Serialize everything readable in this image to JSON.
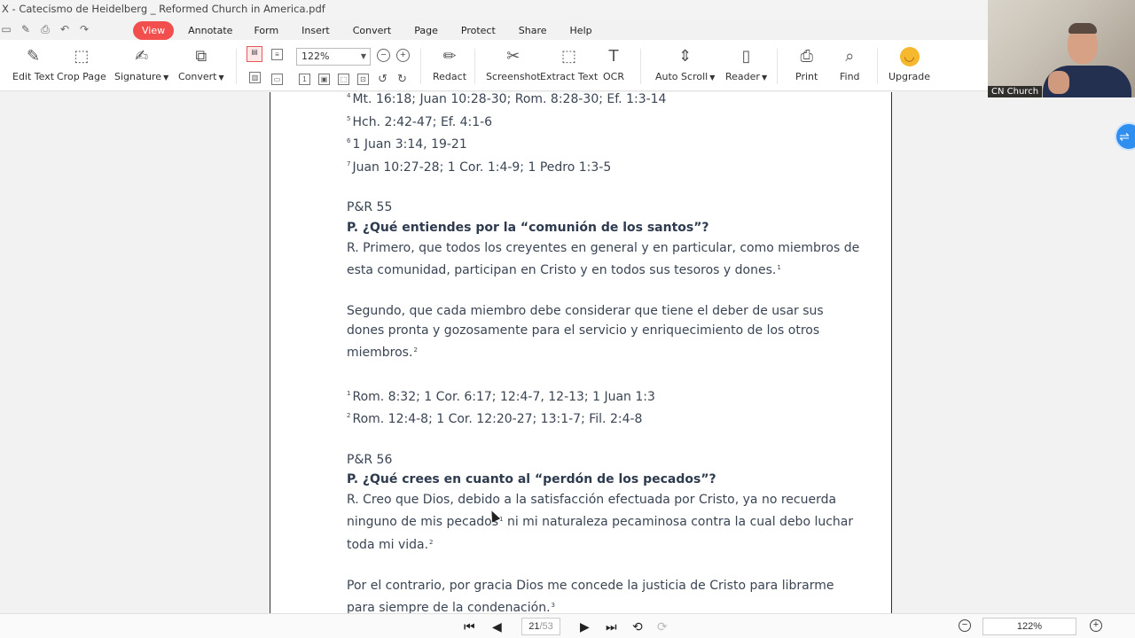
{
  "window": {
    "title": "X - Catecismo de Heidelberg _ Reformed Church in America.pdf"
  },
  "menu": {
    "tabs": [
      {
        "label": "View",
        "active": true
      },
      {
        "label": "Annotate"
      },
      {
        "label": "Form"
      },
      {
        "label": "Insert"
      },
      {
        "label": "Convert"
      },
      {
        "label": "Page"
      },
      {
        "label": "Protect"
      },
      {
        "label": "Share"
      },
      {
        "label": "Help"
      }
    ],
    "accent_color": "#f24e4e"
  },
  "ribbon": {
    "edit_text": "Edit Text",
    "crop_page": "Crop Page",
    "signature": "Signature",
    "convert": "Convert",
    "zoom_value": "122%",
    "redact": "Redact",
    "screenshot": "Screenshot",
    "extract_text": "Extract Text",
    "ocr": "OCR",
    "auto_scroll": "Auto Scroll",
    "reader": "Reader",
    "print": "Print",
    "find": "Find",
    "upgrade": "Upgrade"
  },
  "document": {
    "fn_a": [
      {
        "num": "4",
        "text": "Mt. 16:18; Juan 10:28-30; Rom. 8:28-30; Ef. 1:3-14"
      },
      {
        "num": "5",
        "text": "Hch. 2:42-47; Ef. 4:1-6"
      },
      {
        "num": "6",
        "text": "1 Juan 3:14, 19-21"
      },
      {
        "num": "7",
        "text": "Juan 10:27-28; 1 Cor. 1:4-9; 1 Pedro 1:3-5"
      }
    ],
    "q55": {
      "heading": "P&R 55",
      "question": "P. ¿Qué entiendes por la “comunión de los santos”?",
      "answer_l1": "R. Primero, que todos los creyentes en general y en particular, como miembros de",
      "answer_l2": "esta comunidad, participan en Cristo y en todos sus tesoros y dones.",
      "answer_l2_sup": "1",
      "p2_l1": "Segundo, que cada miembro debe considerar que tiene el deber de usar sus",
      "p2_l2": "dones pronta y gozosamente para el servicio y enriquecimiento de los otros",
      "p2_l3": "miembros.",
      "p2_l3_sup": "2",
      "fn": [
        {
          "num": "1",
          "text": "Rom. 8:32; 1 Cor. 6:17; 12:4-7, 12-13; 1 Juan 1:3"
        },
        {
          "num": "2",
          "text": "Rom. 12:4-8; 1 Cor. 12:20-27; 13:1-7; Fil. 2:4-8"
        }
      ]
    },
    "q56": {
      "heading": "P&R 56",
      "question": "P. ¿Qué crees en cuanto al “perdón de los pecados”?",
      "answer_l1": "R. Creo que Dios, debido a la satisfacción efectuada por Cristo, ya no recuerda",
      "answer_l2a": "ninguno de mis pecados",
      "answer_l2_sup": "1",
      "answer_l2b": " ni mi naturaleza pecaminosa contra la cual debo luchar",
      "answer_l3": "toda mi vida.",
      "answer_l3_sup": "2",
      "p2_l1": "Por el contrario, por gracia Dios me concede la justicia de Cristo para librarme",
      "p2_l2": "para siempre de la condenación.",
      "p2_l2_sup": "3"
    }
  },
  "statusbar": {
    "current_page": "21",
    "total_pages": "/53",
    "zoom": "122%"
  },
  "webcam": {
    "label": "CN Church"
  }
}
